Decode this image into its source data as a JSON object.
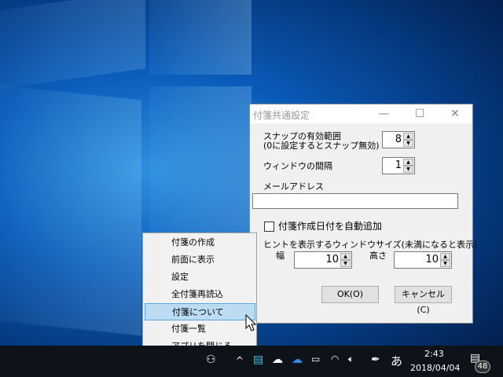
{
  "dialog": {
    "title": "付箋共通設定",
    "minimize": "—",
    "maximize": "☐",
    "close": "✕",
    "snap_label_1": "スナップの有効範囲",
    "snap_label_2": "(0に設定するとスナップ無効)",
    "snap_value": "8",
    "gap_label": "ウィンドウの間隔",
    "gap_value": "1",
    "mail_label": "メールアドレス",
    "mail_value": "",
    "auto_date_label": "付箋作成日付を自動追加",
    "auto_date_checked": false,
    "hint_label": "ヒントを表示するウィンドウサイズ(未満になると表示)",
    "width_label": "幅",
    "width_value": "10",
    "height_label": "高さ",
    "height_value": "10",
    "ok": "OK(O)",
    "cancel": "キャンセル(C)"
  },
  "menu": {
    "items": [
      {
        "label": "付箋の作成"
      },
      {
        "label": "前面に表示"
      },
      {
        "label": "設定"
      },
      {
        "label": "全付箋再読込"
      },
      {
        "label": "付箋について"
      },
      {
        "label": "付箋一覧"
      },
      {
        "label": "アプリを閉じる"
      }
    ],
    "selected_index": 4
  },
  "taskbar": {
    "time": "2:43",
    "date": "2018/04/04",
    "ime": "あ",
    "notifications": "48",
    "chevron": "^"
  }
}
